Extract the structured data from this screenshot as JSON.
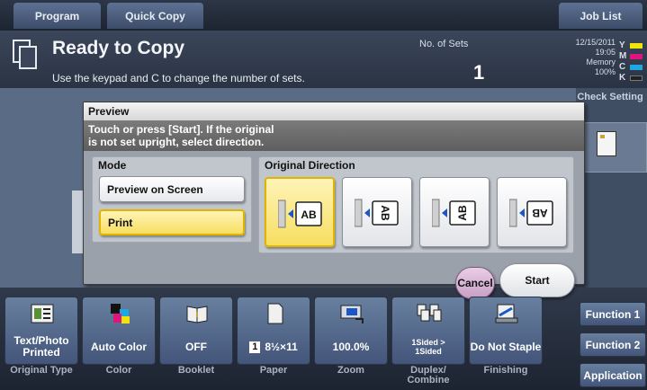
{
  "tabs": [
    {
      "label": "Program"
    },
    {
      "label": "Quick Copy"
    },
    {
      "label": "Job List"
    }
  ],
  "header": {
    "title": "Ready to Copy",
    "subtitle": "Use the keypad and C to change the number of sets.",
    "sets_label": "No. of Sets",
    "sets_value": "1",
    "date": "12/15/2011",
    "time": "19:05",
    "memory_label": "Memory",
    "memory_value": "100%",
    "toner": [
      {
        "letter": "Y",
        "color": "#f2e20d"
      },
      {
        "letter": "M",
        "color": "#e0157b"
      },
      {
        "letter": "C",
        "color": "#1ea7e1"
      },
      {
        "letter": "K",
        "color": "#222222"
      }
    ]
  },
  "right_column": {
    "check_setting": "Check Setting"
  },
  "dialog": {
    "title": "Preview",
    "message_line1": "Touch or press [Start]. If the original",
    "message_line2": "is not set upright, select direction.",
    "mode": {
      "label": "Mode",
      "options": [
        {
          "label": "Preview on Screen",
          "selected": false
        },
        {
          "label": "Print",
          "selected": true
        }
      ]
    },
    "direction": {
      "label": "Original Direction",
      "options": [
        {
          "text": "AB",
          "rotation": 0,
          "selected": true
        },
        {
          "text": "AB",
          "rotation": 90,
          "selected": false
        },
        {
          "text": "AB",
          "rotation": -90,
          "selected": false
        },
        {
          "text": "AB",
          "rotation": 180,
          "selected": false
        }
      ]
    },
    "cancel_label": "Cancel",
    "start_label": "Start"
  },
  "functions": [
    {
      "name": "original-type",
      "value": "Text/Photo Printed",
      "label": "Original Type",
      "icon": "document-text-photo-icon"
    },
    {
      "name": "color",
      "value": "Auto Color",
      "label": "Color",
      "icon": "color-squares-icon"
    },
    {
      "name": "booklet",
      "value": "OFF",
      "label": "Booklet",
      "icon": "booklet-icon"
    },
    {
      "name": "paper",
      "value": "8½×11",
      "tray": "1",
      "label": "Paper",
      "icon": "paper-sheet-icon"
    },
    {
      "name": "zoom",
      "value": "100.0%",
      "label": "Zoom",
      "icon": "zoom-icon"
    },
    {
      "name": "duplex",
      "value_line1": "1Sided >",
      "value_line2": "1Sided",
      "label_line1": "Duplex/",
      "label_line2": "Combine",
      "icon": "duplex-icon"
    },
    {
      "name": "finishing",
      "value": "Do Not Staple",
      "label": "Finishing",
      "icon": "staple-icon"
    }
  ],
  "side_buttons": [
    {
      "label": "Function 1"
    },
    {
      "label": "Function 2"
    },
    {
      "label": "Application"
    }
  ]
}
